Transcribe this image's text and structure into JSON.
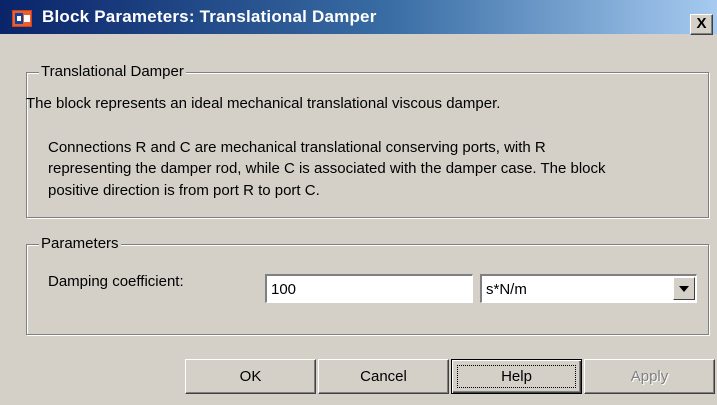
{
  "window": {
    "title": "Block Parameters: Translational Damper",
    "close_glyph": "X",
    "icon": "simulink-block-icon"
  },
  "description_group": {
    "legend": "Translational Damper",
    "lines": [
      "The block represents an ideal mechanical translational viscous damper.",
      "Connections R and C are mechanical translational conserving ports, with R",
      "representing the damper rod, while C is associated with the damper case. The block",
      "positive direction is from port R to port C."
    ]
  },
  "parameters_group": {
    "legend": "Parameters",
    "damping": {
      "label": "Damping coefficient:",
      "value": "100",
      "unit": "s*N/m"
    }
  },
  "buttons": {
    "ok": "OK",
    "cancel": "Cancel",
    "help": "Help",
    "apply": "Apply"
  }
}
